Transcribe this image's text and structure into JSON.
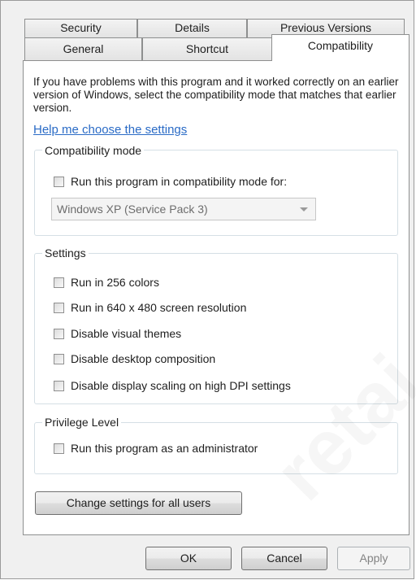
{
  "tabs": {
    "row1": [
      "Security",
      "Details",
      "Previous Versions"
    ],
    "row2": [
      "General",
      "Shortcut",
      "Compatibility"
    ],
    "active": "Compatibility"
  },
  "intro_text": "If you have problems with this program and it worked correctly on an earlier version of Windows, select the compatibility mode that matches that earlier version.",
  "help_link": "Help me choose the settings",
  "compat_mode": {
    "title": "Compatibility mode",
    "checkbox_label": "Run this program in compatibility mode for:",
    "checked": false,
    "selected_os": "Windows XP (Service Pack 3)"
  },
  "settings": {
    "title": "Settings",
    "options": [
      {
        "label": "Run in 256 colors",
        "checked": false
      },
      {
        "label": "Run in 640 x 480 screen resolution",
        "checked": false
      },
      {
        "label": "Disable visual themes",
        "checked": false
      },
      {
        "label": "Disable desktop composition",
        "checked": false
      },
      {
        "label": "Disable display scaling on high DPI settings",
        "checked": false
      }
    ]
  },
  "privilege": {
    "title": "Privilege Level",
    "checkbox_label": "Run this program as an administrator",
    "checked": false
  },
  "change_all_users_button": "Change settings for all users",
  "footer": {
    "ok": "OK",
    "cancel": "Cancel",
    "apply": "Apply"
  },
  "watermark_text": "retai"
}
